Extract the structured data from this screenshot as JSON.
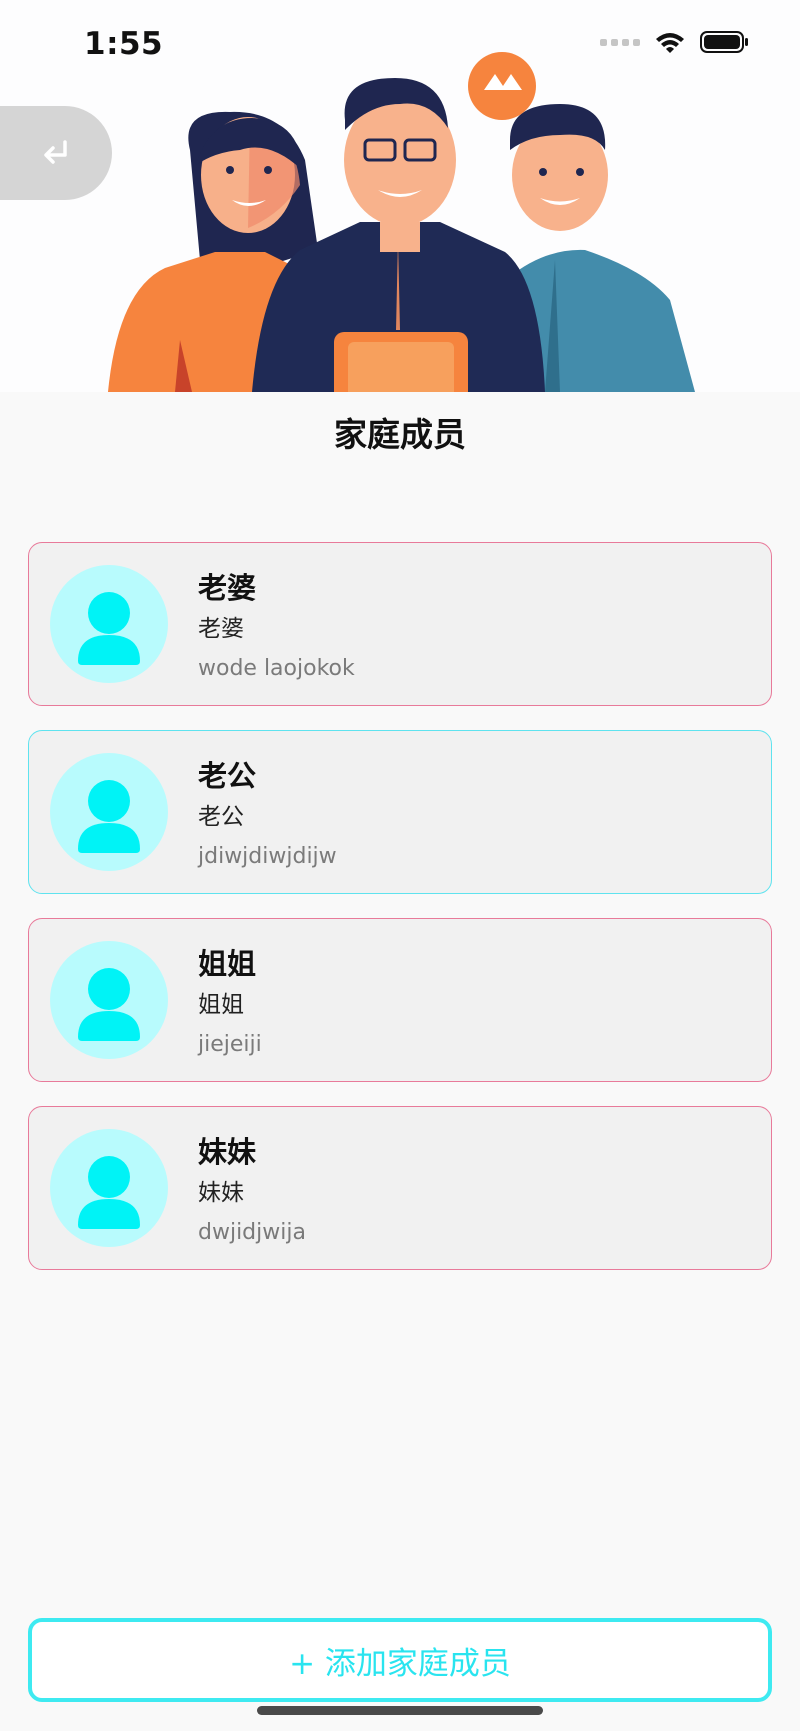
{
  "status_bar": {
    "time": "1:55",
    "icons": [
      "cellular-signal-icon",
      "wifi-icon",
      "battery-icon"
    ]
  },
  "header": {
    "back_icon": "return-arrow-icon",
    "illustration": "family-illustration",
    "title": "家庭成员"
  },
  "members": [
    {
      "name": "老婆",
      "role": "老婆",
      "note": "wode laojokok",
      "avatar_icon": "person-avatar-icon"
    },
    {
      "name": "老公",
      "role": "老公",
      "note": "jdiwjdiwjdijw",
      "avatar_icon": "person-avatar-icon"
    },
    {
      "name": "姐姐",
      "role": "姐姐",
      "note": "jiejeiji",
      "avatar_icon": "person-avatar-icon"
    },
    {
      "name": "妹妹",
      "role": "妹妹",
      "note": "dwjidjwija",
      "avatar_icon": "person-avatar-icon"
    }
  ],
  "add_button": {
    "label": "+ 添加家庭成员"
  },
  "colors": {
    "accent": "#3eeaf1",
    "card_border": "#e87a9a",
    "card_border_selected": "#5fe3ef",
    "avatar_bg": "#b8fbfd",
    "avatar_fg": "#00f3f6"
  }
}
